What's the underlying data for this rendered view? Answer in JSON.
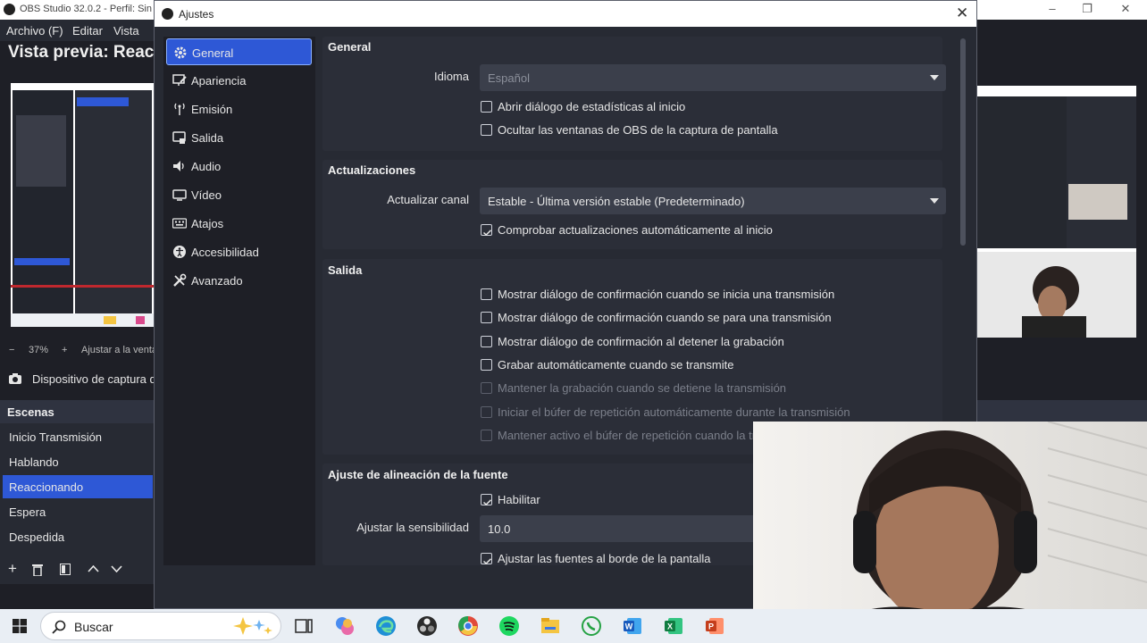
{
  "obs_window": {
    "title": "OBS Studio 32.0.2 - Perfil: Sin",
    "menu": [
      "Archivo (F)",
      "Editar",
      "Vista"
    ],
    "preview_title": "Vista previa: Reac",
    "zoom_label": "37%",
    "fit_label": "Ajustar a la venta",
    "source_label": "Dispositivo de captura d",
    "scenes_header": "Escenas",
    "scenes": [
      "Inicio Transmisión",
      "Hablando",
      "Reaccionando",
      "Espera",
      "Despedida"
    ],
    "selected_scene": "Reaccionando"
  },
  "dialog": {
    "title": "Ajustes",
    "nav": [
      {
        "label": "General",
        "icon": "gear-icon"
      },
      {
        "label": "Apariencia",
        "icon": "appearance-icon"
      },
      {
        "label": "Emisión",
        "icon": "antenna-icon"
      },
      {
        "label": "Salida",
        "icon": "output-icon"
      },
      {
        "label": "Audio",
        "icon": "speaker-icon"
      },
      {
        "label": "Vídeo",
        "icon": "monitor-icon"
      },
      {
        "label": "Atajos",
        "icon": "keyboard-icon"
      },
      {
        "label": "Accesibilidad",
        "icon": "accessibility-icon"
      },
      {
        "label": "Avanzado",
        "icon": "tools-icon"
      }
    ],
    "general": {
      "title": "General",
      "language_label": "Idioma",
      "language_value": "Español",
      "chk_stats": "Abrir diálogo de estadísticas al inicio",
      "chk_hide": "Ocultar las ventanas de OBS de la captura de pantalla"
    },
    "updates": {
      "title": "Actualizaciones",
      "channel_label": "Actualizar canal",
      "channel_value": "Estable - Última versión estable (Predeterminado)",
      "chk_auto": "Comprobar actualizaciones automáticamente al inicio"
    },
    "output": {
      "title": "Salida",
      "checks": [
        {
          "label": "Mostrar diálogo de confirmación cuando se inicia una transmisión",
          "checked": false,
          "disabled": false
        },
        {
          "label": "Mostrar diálogo de confirmación cuando se para una transmisión",
          "checked": false,
          "disabled": false
        },
        {
          "label": "Mostrar diálogo de confirmación al detener la grabación",
          "checked": false,
          "disabled": false
        },
        {
          "label": "Grabar automáticamente cuando se transmite",
          "checked": false,
          "disabled": false
        },
        {
          "label": "Mantener la grabación cuando se detiene la transmisión",
          "checked": false,
          "disabled": true
        },
        {
          "label": "Iniciar el búfer de repetición automáticamente durante la transmisión",
          "checked": false,
          "disabled": true
        },
        {
          "label": "Mantener activo el búfer de repetición cuando la tra",
          "checked": false,
          "disabled": true
        }
      ]
    },
    "snapping": {
      "title": "Ajuste de alineación de la fuente",
      "chk_enable": "Habilitar",
      "sensitivity_label": "Ajustar la sensibilidad",
      "sensitivity_value": "10.0",
      "chk_edges": "Ajustar las fuentes al borde de la pantalla"
    }
  },
  "taskbar": {
    "search_label": "Buscar",
    "apps": [
      "windows-start-icon",
      "task-view-icon",
      "copilot-icon",
      "edge-icon",
      "obs-icon",
      "chrome-icon",
      "spotify-icon",
      "explorer-icon",
      "whatsapp-icon",
      "word-icon",
      "excel-icon",
      "powerpoint-icon"
    ]
  },
  "colors": {
    "accent": "#2e58d6",
    "panel": "#272a33",
    "group": "#2b2e38",
    "input": "#3b3f4b"
  }
}
